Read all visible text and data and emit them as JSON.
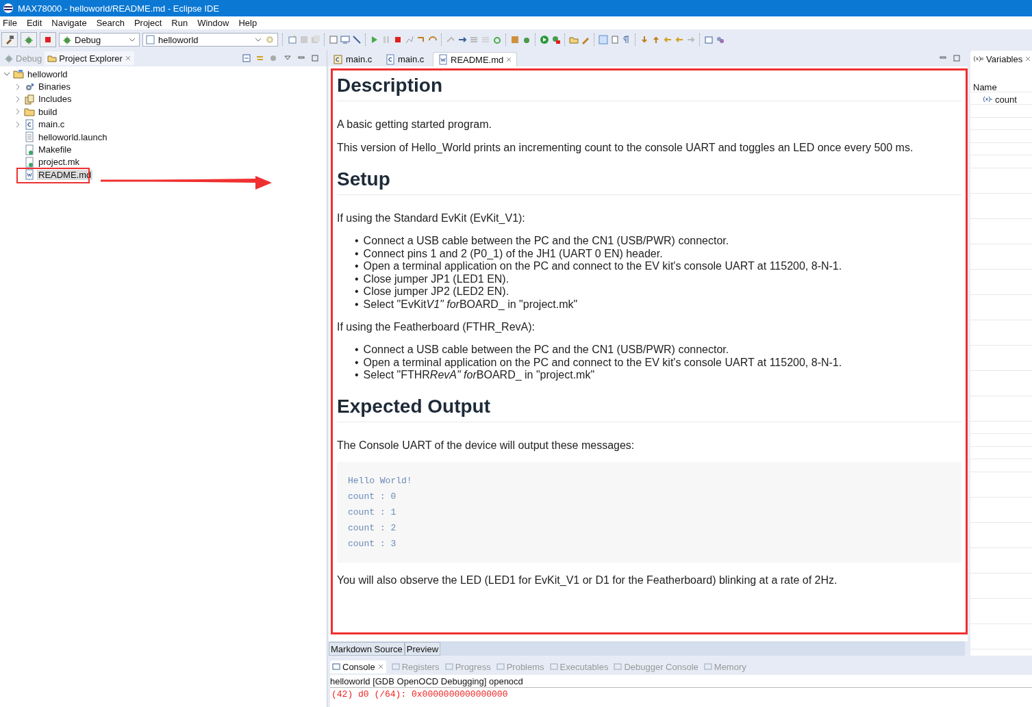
{
  "window": {
    "title": "MAX78000 - helloworld/README.md - Eclipse IDE"
  },
  "menu": [
    "File",
    "Edit",
    "Navigate",
    "Search",
    "Project",
    "Run",
    "Window",
    "Help"
  ],
  "toolbar": {
    "launch_mode": "Debug",
    "launch_target": "helloworld"
  },
  "left_panel": {
    "tabs": [
      {
        "label": "Debug",
        "selected": false
      },
      {
        "label": "Project Explorer",
        "selected": true
      }
    ],
    "tree": [
      {
        "label": "helloworld",
        "kind": "project",
        "expanded": true,
        "selected": false,
        "children": [
          {
            "label": "Binaries",
            "kind": "binaries",
            "expanded": false,
            "selected": false
          },
          {
            "label": "Includes",
            "kind": "includes",
            "expanded": false,
            "selected": false
          },
          {
            "label": "build",
            "kind": "folder",
            "expanded": false,
            "selected": false
          },
          {
            "label": "main.c",
            "kind": "cfile",
            "expanded": false,
            "selected": false
          },
          {
            "label": "helloworld.launch",
            "kind": "file",
            "selected": false
          },
          {
            "label": "Makefile",
            "kind": "makefile",
            "selected": false
          },
          {
            "label": "project.mk",
            "kind": "makefile",
            "selected": false
          },
          {
            "label": "README.md",
            "kind": "doc",
            "selected": true
          }
        ]
      }
    ]
  },
  "editor": {
    "tabs": [
      {
        "label": "main.c",
        "kind": "cfile-alt",
        "selected": false
      },
      {
        "label": "main.c",
        "kind": "cfile",
        "selected": false
      },
      {
        "label": "README.md",
        "kind": "doc",
        "selected": true
      }
    ],
    "sections": [
      {
        "heading": "Description",
        "blocks": [
          {
            "kind": "paragraph",
            "text": "A basic getting started program."
          },
          {
            "kind": "paragraph",
            "text": "This version of Hello_World prints an incrementing count to the console UART and toggles an LED once every 500 ms."
          }
        ]
      },
      {
        "heading": "Setup",
        "blocks": [
          {
            "kind": "paragraph",
            "text": "If using the Standard EvKit (EvKit_V1):"
          },
          {
            "kind": "list",
            "marker": "•",
            "items": [
              "Connect a USB cable between the PC and the CN1 (USB/PWR) connector.",
              "Connect pins 1 and 2 (P0_1) of the JH1 (UART 0 EN) header.",
              "Open a terminal application on the PC and connect to the EV kit's console UART at 115200, 8-N-1.",
              "Close jumper JP1 (LED1 EN).",
              "Close jumper JP2 (LED2 EN).",
              {
                "parts": [
                  {
                    "text": "Select \"EvKit",
                    "italic": false
                  },
                  {
                    "text": "V1\" for",
                    "italic": true
                  },
                  {
                    "text": "BOARD_ in \"project.mk\"",
                    "italic": false
                  }
                ]
              }
            ]
          },
          {
            "kind": "paragraph",
            "text": "If using the Featherboard (FTHR_RevA):"
          },
          {
            "kind": "list",
            "marker": "•",
            "items": [
              "Connect a USB cable between the PC and the CN1 (USB/PWR) connector.",
              "Open a terminal application on the PC and connect to the EV kit's console UART at 115200, 8-N-1.",
              {
                "parts": [
                  {
                    "text": "Select \"FTHR",
                    "italic": false
                  },
                  {
                    "text": "RevA\" for",
                    "italic": true
                  },
                  {
                    "text": "BOARD_ in \"project.mk\"",
                    "italic": false
                  }
                ]
              }
            ]
          }
        ]
      },
      {
        "heading": "Expected Output",
        "blocks": [
          {
            "kind": "paragraph",
            "text": "The Console UART of the device will output these messages:"
          },
          {
            "kind": "code",
            "lines": [
              "Hello World!",
              "count : 0",
              "count : 1",
              "count : 2",
              "count : 3"
            ]
          },
          {
            "kind": "paragraph",
            "text": "You will also observe the LED (LED1 for EvKit_V1 or D1 for the Featherboard) blinking at a rate of 2Hz."
          }
        ]
      }
    ],
    "bottom_tabs": [
      "Markdown Source",
      "Preview"
    ]
  },
  "variables": {
    "title": "Variables",
    "column": "Name",
    "rows": [
      "count"
    ]
  },
  "console": {
    "tabs": [
      {
        "label": "Console",
        "selected": true
      },
      {
        "label": "Registers",
        "selected": false
      },
      {
        "label": "Progress",
        "selected": false
      },
      {
        "label": "Problems",
        "selected": false
      },
      {
        "label": "Executables",
        "selected": false
      },
      {
        "label": "Debugger Console",
        "selected": false
      },
      {
        "label": "Memory",
        "selected": false
      }
    ],
    "header": "helloworld [GDB OpenOCD Debugging] openocd",
    "lines": [
      "(42) d0 (/64): 0x0000000000000000"
    ]
  }
}
